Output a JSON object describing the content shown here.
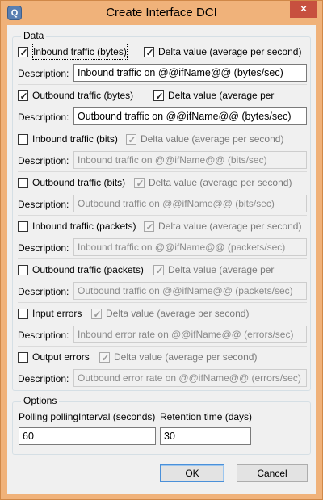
{
  "window": {
    "title": "Create Interface DCI",
    "app_icon": "netxms-app-icon",
    "close_glyph": "×",
    "colors": {
      "frame": "#f0b27a",
      "close": "#c7503f",
      "client": "#f0f0f0"
    }
  },
  "data_group": {
    "legend": "Data",
    "description_label": "Description:",
    "entries": [
      {
        "checked": true,
        "label": "Inbound traffic (bytes)",
        "delta_checked": true,
        "delta_enabled": true,
        "delta_label": "Delta value (average per second)",
        "description": "Inbound traffic on @@ifName@@ (bytes/sec)",
        "enabled": true
      },
      {
        "checked": true,
        "label": "Outbound traffic (bytes)",
        "delta_checked": true,
        "delta_enabled": true,
        "delta_label": "Delta value (average per second)",
        "description": "Outbound traffic on @@ifName@@ (bytes/sec)",
        "enabled": true
      },
      {
        "checked": false,
        "label": "Inbound traffic (bits)",
        "delta_checked": true,
        "delta_enabled": false,
        "delta_label": "Delta value (average per second)",
        "description": "Inbound traffic on @@ifName@@ (bits/sec)",
        "enabled": false
      },
      {
        "checked": false,
        "label": "Outbound traffic (bits)",
        "delta_checked": true,
        "delta_enabled": false,
        "delta_label": "Delta value (average per second)",
        "description": "Outbound traffic on @@ifName@@ (bits/sec)",
        "enabled": false
      },
      {
        "checked": false,
        "label": "Inbound traffic (packets)",
        "delta_checked": true,
        "delta_enabled": false,
        "delta_label": "Delta value (average per second)",
        "description": "Inbound traffic on @@ifName@@ (packets/sec)",
        "enabled": false
      },
      {
        "checked": false,
        "label": "Outbound traffic (packets)",
        "delta_checked": true,
        "delta_enabled": false,
        "delta_label": "Delta value (average per second)",
        "description": "Outbound traffic on @@ifName@@ (packets/sec)",
        "enabled": false
      },
      {
        "checked": false,
        "label": "Input errors",
        "delta_checked": true,
        "delta_enabled": false,
        "delta_label": "Delta value (average per second)",
        "description": "Inbound error rate on @@ifName@@ (errors/sec)",
        "enabled": false
      },
      {
        "checked": false,
        "label": "Output errors",
        "delta_checked": true,
        "delta_enabled": false,
        "delta_label": "Delta value (average per second)",
        "description": "Outbound error rate on @@ifName@@ (errors/sec)",
        "enabled": false
      }
    ]
  },
  "options_group": {
    "legend": "Options",
    "polling_label": "Polling pollingInterval (seconds)",
    "polling_value": "60",
    "retention_label": "Retention time (days)",
    "retention_value": "30"
  },
  "buttons": {
    "ok": "OK",
    "cancel": "Cancel"
  }
}
